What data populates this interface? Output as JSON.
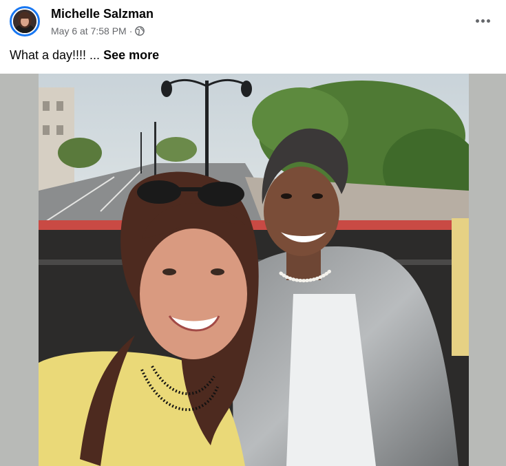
{
  "post": {
    "author": "Michelle Salzman",
    "timestamp": "May 6 at 7:58 PM",
    "separator": "·",
    "audience_icon": "globe-icon",
    "caption_text": "What a day!!!! ...",
    "see_more_label": "See more",
    "options_icon": "more-options-icon"
  },
  "photo": {
    "description_icon": "photo"
  },
  "colors": {
    "accent": "#1877f2",
    "text_primary": "#050505",
    "text_secondary": "#65676b",
    "letterbox": "#b8bab7"
  }
}
